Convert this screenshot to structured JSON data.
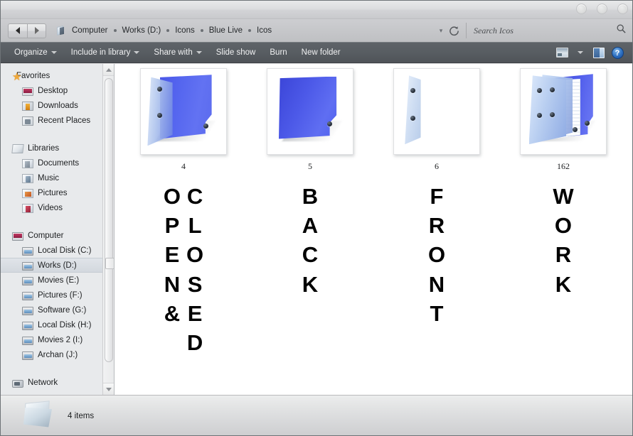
{
  "window": {
    "controls": [
      "minimize-button",
      "maximize-button",
      "close-button"
    ]
  },
  "address_bar": {
    "back_label": "Back",
    "forward_label": "Forward",
    "breadcrumbs": [
      "Computer",
      "Works (D:)",
      "Icons",
      "Blue Live",
      "Icos"
    ],
    "dropdown_label": "▾",
    "refresh_label": "Refresh"
  },
  "search": {
    "placeholder": "Search Icos",
    "value": ""
  },
  "toolbar": {
    "items": [
      {
        "label": "Organize",
        "has_caret": true
      },
      {
        "label": "Include in library",
        "has_caret": true
      },
      {
        "label": "Share with",
        "has_caret": true
      },
      {
        "label": "Slide show",
        "has_caret": false
      },
      {
        "label": "Burn",
        "has_caret": false
      },
      {
        "label": "New folder",
        "has_caret": false
      }
    ],
    "views_label": "Change your view",
    "views_caret": "▾",
    "preview_pane_label": "Show the preview pane",
    "help_label": "?"
  },
  "sidebar": {
    "groups": [
      {
        "header": {
          "label": "Favorites",
          "icon": "star-icon"
        },
        "items": [
          {
            "label": "Desktop",
            "icon": "desktop-icon"
          },
          {
            "label": "Downloads",
            "icon": "downloads-icon"
          },
          {
            "label": "Recent Places",
            "icon": "recent-places-icon"
          }
        ]
      },
      {
        "header": {
          "label": "Libraries",
          "icon": "libraries-icon"
        },
        "items": [
          {
            "label": "Documents",
            "icon": "documents-icon"
          },
          {
            "label": "Music",
            "icon": "music-icon"
          },
          {
            "label": "Pictures",
            "icon": "pictures-icon"
          },
          {
            "label": "Videos",
            "icon": "videos-icon"
          }
        ]
      },
      {
        "header": {
          "label": "Computer",
          "icon": "computer-icon"
        },
        "items": [
          {
            "label": "Local Disk (C:)",
            "icon": "drive-icon",
            "selected": false
          },
          {
            "label": "Works (D:)",
            "icon": "drive-icon",
            "selected": true
          },
          {
            "label": "Movies (E:)",
            "icon": "drive-icon",
            "selected": false
          },
          {
            "label": "Pictures (F:)",
            "icon": "drive-icon",
            "selected": false
          },
          {
            "label": "Software (G:)",
            "icon": "drive-icon",
            "selected": false
          },
          {
            "label": "Local Disk (H:)",
            "icon": "drive-icon",
            "selected": false
          },
          {
            "label": "Movies  2 (I:)",
            "icon": "drive-icon",
            "selected": false
          },
          {
            "label": "Archan (J:)",
            "icon": "drive-icon",
            "selected": false
          }
        ]
      },
      {
        "header": {
          "label": "Network",
          "icon": "network-icon"
        },
        "items": []
      }
    ]
  },
  "files": {
    "items": [
      {
        "label": "4",
        "thumb": "folder-open-blue",
        "words": [
          "OPEN&",
          "CLOSED"
        ]
      },
      {
        "label": "5",
        "thumb": "folder-flat-blue",
        "words": [
          "BACK"
        ]
      },
      {
        "label": "6",
        "thumb": "folder-empty-pale",
        "words": [
          "FRONT"
        ]
      },
      {
        "label": "162",
        "thumb": "folder-stack-blue",
        "words": [
          "WORK"
        ]
      }
    ]
  },
  "status_bar": {
    "icon": "folder-icon",
    "text": "4 items"
  },
  "colors": {
    "toolbar_bg": "#585d62",
    "sidebar_bg": "#e8eaec",
    "pane_bg": "#ffffff",
    "folder_blue": "#5566ef",
    "folder_pale": "#cfdef3",
    "help_blue": "#2d6fc0",
    "favorites_star": "#f0a93b"
  }
}
